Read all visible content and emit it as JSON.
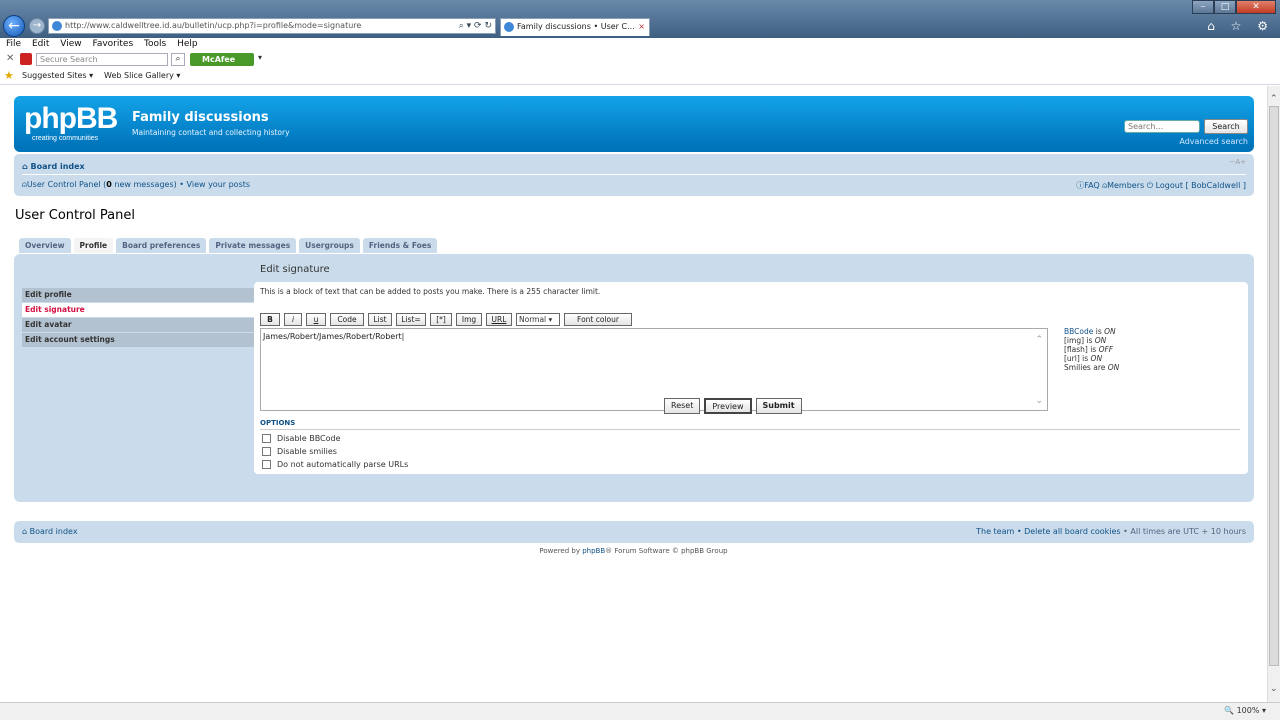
{
  "browser": {
    "address": "http://www.caldwelltree.id.au/bulletin/ucp.php?i=profile&mode=signature",
    "address_tools": "⌕ ▾ ⟳ ↻",
    "tab_title": "Family discussions • User C...",
    "tab_close": "×",
    "menu": [
      "File",
      "Edit",
      "View",
      "Favorites",
      "Tools",
      "Help"
    ],
    "secure_search_placeholder": "Secure Search",
    "mcafee_label": "McAfee",
    "fav_suggested": "Suggested Sites ▾",
    "fav_webslice": "Web Slice Gallery ▾",
    "zoom": "100%",
    "window_buttons": [
      "⎯",
      "□",
      "✕"
    ],
    "ie_tools": "⌂ ☆ ⚙"
  },
  "header": {
    "logo_text": "phpBB",
    "logo_tagline": "creating   communities",
    "site_name": "Family discussions",
    "site_desc": "Maintaining contact and collecting history",
    "search_placeholder": "Search...",
    "search_button": "Search",
    "advanced_search": "Advanced search"
  },
  "navbar": {
    "board_index": "Board index",
    "font_controls": "−A+",
    "ucp_text_pre": "User Control Panel (",
    "ucp_count": "0",
    "ucp_text_post": " new messages) • View your posts",
    "faq": "FAQ",
    "members": "Members",
    "logout": "Logout [ BobCaldwell ]"
  },
  "page_title": "User Control Panel",
  "tabs": [
    "Overview",
    "Profile",
    "Board preferences",
    "Private messages",
    "Usergroups",
    "Friends & Foes"
  ],
  "sidebar": [
    "Edit profile",
    "Edit signature",
    "Edit avatar",
    "Edit account settings"
  ],
  "content": {
    "title": "Edit signature",
    "description": "This is a block of text that can be added to posts you make. There is a 255 character limit.",
    "bbcode_buttons": [
      "B",
      "i",
      "u",
      "Code",
      "List",
      "List=",
      "[*]",
      "Img",
      "URL"
    ],
    "font_size_value": "Normal",
    "font_colour_button": "Font colour",
    "signature_text": "James/Robert/James/Robert/Robert",
    "status": {
      "bbcode_link": "BBCode",
      "bbcode_is": " is ",
      "bbcode_state": "ON",
      "img_label": "[img] is ",
      "img_state": "ON",
      "flash_label": "[flash] is ",
      "flash_state": "OFF",
      "url_label": "[url] is ",
      "url_state": "ON",
      "smilies_label": "Smilies are ",
      "smilies_state": "ON"
    },
    "options_heading": "OPTIONS",
    "options": [
      "Disable BBCode",
      "Disable smilies",
      "Do not automatically parse URLs"
    ],
    "buttons": {
      "reset": "Reset",
      "preview": "Preview",
      "submit": "Submit"
    }
  },
  "footer": {
    "board_index": "Board index",
    "team": "The team • Delete all board cookies",
    "timezone": " • All times are UTC + 10 hours",
    "powered_pre": "Powered by ",
    "powered_link": "phpBB",
    "powered_post": "® Forum Software © phpBB Group"
  },
  "colors": {
    "header_blue": "#0f8fd8",
    "nav_bg": "#cadceb",
    "active_red": "#d31141",
    "link": "#105289"
  }
}
